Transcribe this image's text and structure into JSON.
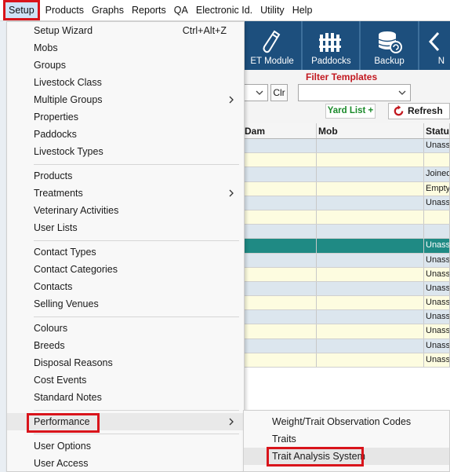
{
  "menubar": {
    "items": [
      "Setup",
      "Products",
      "Graphs",
      "Reports",
      "QA",
      "Electronic Id.",
      "Utility",
      "Help"
    ]
  },
  "toolbar": {
    "buttons": [
      "ET Module",
      "Paddocks",
      "Backup",
      "N"
    ]
  },
  "filter": {
    "title": "Filter Templates",
    "clear_label": "Clr",
    "yard_list_label": "Yard List +",
    "refresh_label": "Refresh"
  },
  "grid": {
    "columns": [
      "Dam",
      "Mob",
      "Status"
    ],
    "rows": [
      {
        "status": "Unass"
      },
      {
        "status": ""
      },
      {
        "status": "Joined"
      },
      {
        "status": "Empty"
      },
      {
        "status": "Unass"
      },
      {
        "status": ""
      },
      {
        "status": ""
      },
      {
        "status": "Unass"
      },
      {
        "status": "Unass"
      },
      {
        "status": "Unass"
      },
      {
        "status": "Unass"
      },
      {
        "status": "Unass"
      },
      {
        "status": "Unass"
      },
      {
        "status": "Unass"
      },
      {
        "status": "Unass"
      },
      {
        "status": "Unass"
      }
    ]
  },
  "setup_menu": {
    "setup_wizard": "Setup Wizard",
    "setup_wizard_shortcut": "Ctrl+Alt+Z",
    "mobs": "Mobs",
    "groups": "Groups",
    "livestock_class": "Livestock Class",
    "multiple_groups": "Multiple Groups",
    "properties": "Properties",
    "paddocks": "Paddocks",
    "livestock_types": "Livestock Types",
    "products": "Products",
    "treatments": "Treatments",
    "veterinary_activities": "Veterinary Activities",
    "user_lists": "User Lists",
    "contact_types": "Contact Types",
    "contact_categories": "Contact Categories",
    "contacts": "Contacts",
    "selling_venues": "Selling Venues",
    "colours": "Colours",
    "breeds": "Breeds",
    "disposal_reasons": "Disposal Reasons",
    "cost_events": "Cost Events",
    "standard_notes": "Standard Notes",
    "performance": "Performance",
    "user_options": "User Options",
    "user_access": "User Access"
  },
  "performance_submenu": {
    "weight_trait_codes": "Weight/Trait Observation Codes",
    "traits": "Traits",
    "trait_analysis_system": "Trait Analysis System"
  },
  "colors": {
    "highlight_box": "#d9141b",
    "toolbar_bg": "#1d4f7d",
    "selected_row": "#1f8a84"
  }
}
